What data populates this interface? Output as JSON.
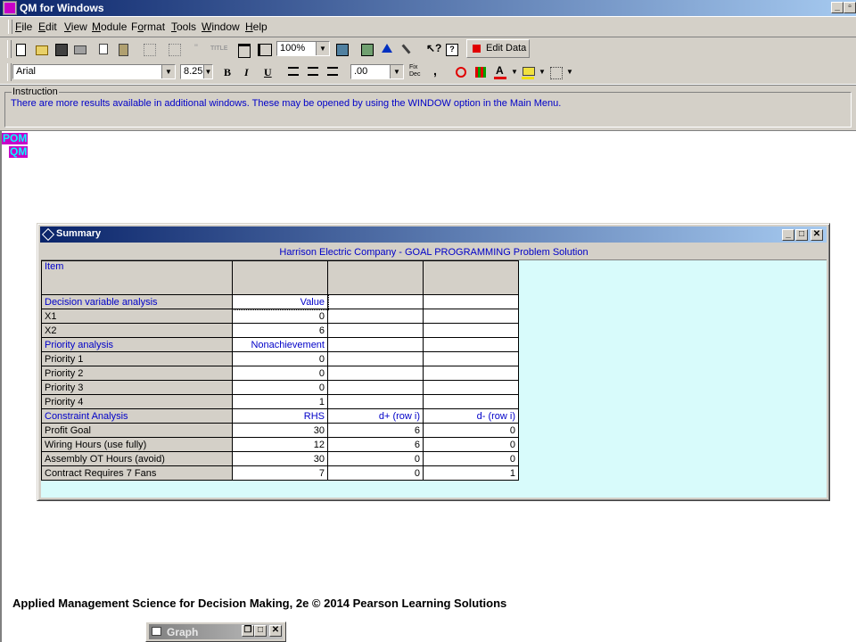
{
  "app": {
    "title": "QM for Windows"
  },
  "menu": {
    "items": [
      {
        "label": "File",
        "underline": "F"
      },
      {
        "label": "Edit",
        "underline": "E"
      },
      {
        "label": "View",
        "underline": "V"
      },
      {
        "label": "Module",
        "underline": "M"
      },
      {
        "label": "Format",
        "underline": "o"
      },
      {
        "label": "Tools",
        "underline": "T"
      },
      {
        "label": "Window",
        "underline": "W"
      },
      {
        "label": "Help",
        "underline": "H"
      }
    ]
  },
  "toolbar1": {
    "zoom": "100%",
    "edit_data_label": "Edit Data",
    "title_btn_label": "TITLE"
  },
  "toolbar2": {
    "font_name": "Arial",
    "font_size": "8.25",
    "bold_label": "B",
    "italic_label": "I",
    "underline_label": "U",
    "decimals": ".00",
    "fix_dec_label": "Fix Dec",
    "comma_label": ","
  },
  "instruction": {
    "label": "Instruction",
    "text": "There are more results available in additional windows. These may be opened by using the WINDOW option in the Main Menu."
  },
  "logo": {
    "line1": "POM",
    "line2": "QM"
  },
  "summary": {
    "title": "Summary",
    "heading": "Harrison Electric Company - GOAL PROGRAMMING Problem Solution",
    "item_header": "Item",
    "rows": [
      {
        "label": "Decision variable analysis",
        "c1": "Value",
        "c2": "",
        "c3": "",
        "section": true
      },
      {
        "label": "X1",
        "c1": "0",
        "c2": "",
        "c3": ""
      },
      {
        "label": "X2",
        "c1": "6",
        "c2": "",
        "c3": ""
      },
      {
        "label": "Priority analysis",
        "c1": "Nonachievement",
        "c2": "",
        "c3": "",
        "section": true
      },
      {
        "label": "Priority 1",
        "c1": "0",
        "c2": "",
        "c3": ""
      },
      {
        "label": "Priority 2",
        "c1": "0",
        "c2": "",
        "c3": ""
      },
      {
        "label": "Priority 3",
        "c1": "0",
        "c2": "",
        "c3": ""
      },
      {
        "label": "Priority 4",
        "c1": "1",
        "c2": "",
        "c3": ""
      },
      {
        "label": "Constraint Analysis",
        "c1": "RHS",
        "c2": "d+ (row i)",
        "c3": "d- (row i)",
        "section": true
      },
      {
        "label": "Profit Goal",
        "c1": "30",
        "c2": "6",
        "c3": "0"
      },
      {
        "label": "Wiring Hours (use fully)",
        "c1": "12",
        "c2": "6",
        "c3": "0"
      },
      {
        "label": "Assembly OT Hours (avoid)",
        "c1": "30",
        "c2": "0",
        "c3": "0"
      },
      {
        "label": "Contract Requires 7 Fans",
        "c1": "7",
        "c2": "0",
        "c3": "1"
      }
    ]
  },
  "footer": {
    "text": "Applied Management Science for Decision Making, 2e © 2014 Pearson Learning Solutions"
  },
  "graph_window": {
    "title": "Graph"
  },
  "colors": {
    "title_active_start": "#0a246a",
    "title_active_end": "#a6caf0",
    "chrome": "#d4d0c8",
    "blue_text": "#0000c8",
    "grid_bg": "#d8fbfb"
  }
}
